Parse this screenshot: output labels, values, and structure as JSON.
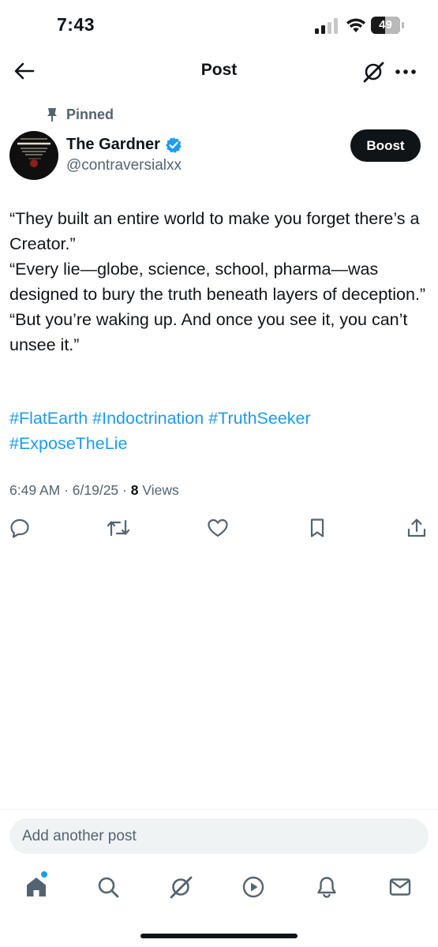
{
  "status_bar": {
    "time": "7:43",
    "battery": "49",
    "battery_level_percent": 49
  },
  "header": {
    "title": "Post",
    "back_icon": "arrow-left-icon",
    "grok_icon": "grok-icon",
    "more_icon": "more-dots-icon"
  },
  "post": {
    "pinned_label": "Pinned",
    "author": {
      "name": "The Gardner",
      "handle": "@contraversialxx",
      "verified": true
    },
    "boost_label": "Boost",
    "paragraphs": [
      "“They built an entire world to make you forget there’s a Creator.”",
      "“Every lie—globe, science, school, pharma—was designed to bury the truth beneath layers of deception.”",
      "“But you’re waking up. And once you see it, you can’t unsee it.”"
    ],
    "hashtags": [
      "#FlatEarth",
      "#Indoctrination",
      "#TruthSeeker",
      "#ExposeTheLie"
    ],
    "time": "6:49 AM",
    "date": "6/19/25",
    "views_count": "8",
    "views_label": "Views"
  },
  "composer": {
    "placeholder": "Add another post"
  },
  "tab_bar": {
    "items": [
      "home",
      "search",
      "grok",
      "video",
      "notifications",
      "messages"
    ]
  },
  "colors": {
    "accent": "#1d9bf0",
    "text_primary": "#0f1419",
    "text_secondary": "#536471"
  }
}
